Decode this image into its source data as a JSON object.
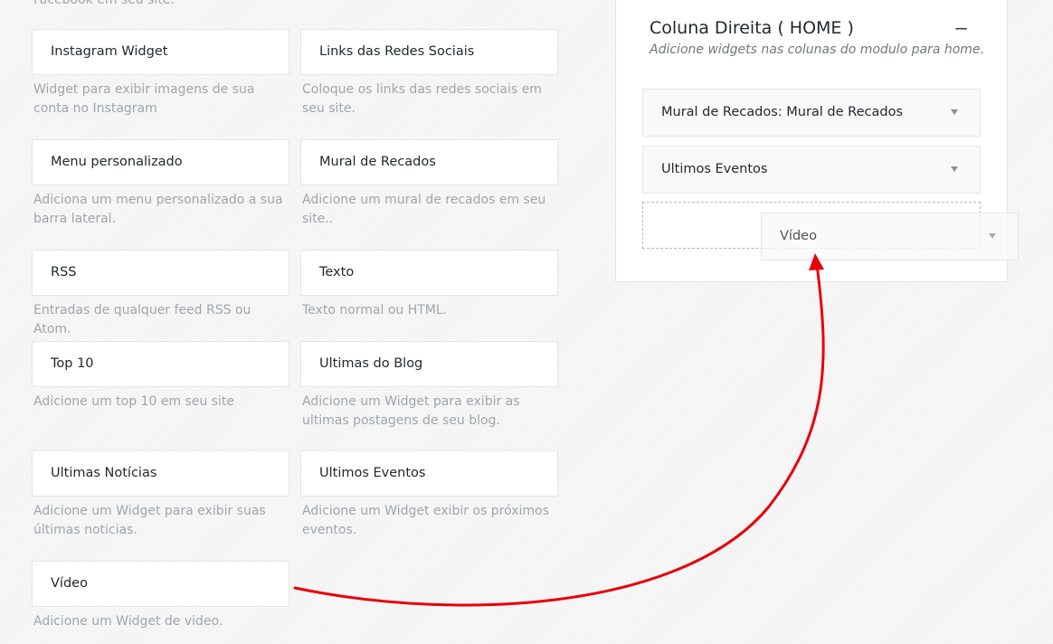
{
  "available_widgets": {
    "top_cut_description": "Facebook em seu site.",
    "items": [
      {
        "title": "Instagram Widget",
        "description": "Widget para exibir imagens de sua conta no Instagram"
      },
      {
        "title": "Links das Redes Sociais",
        "description": "Coloque os links das redes sociais em seu site."
      },
      {
        "title": "Menu personalizado",
        "description": "Adiciona um menu personalizado a sua barra lateral."
      },
      {
        "title": "Mural de Recados",
        "description": "Adicione um mural de recados em seu site.."
      },
      {
        "title": "RSS",
        "description": "Entradas de qualquer feed RSS ou Atom."
      },
      {
        "title": "Texto",
        "description": "Texto normal ou HTML."
      },
      {
        "title": "Top 10",
        "description": "Adicione um top 10 em seu site"
      },
      {
        "title": "Ultimas do Blog",
        "description": "Adicione um Widget para exibir as ultimas postagens de seu blog."
      },
      {
        "title": "Ultimas Notícias",
        "description": "Adicione um Widget para exibir suas últimas noticias."
      },
      {
        "title": "Ultimos Eventos",
        "description": "Adicione um Widget exibir os próximos eventos."
      },
      {
        "title": "Vídeo",
        "description": "Adicione um Widget de video."
      }
    ]
  },
  "sidebar": {
    "title": "Coluna Direita ( HOME )",
    "toggle_symbol": "−",
    "subtitle": "Adicione widgets nas colunas do modulo para home.",
    "widgets": [
      {
        "label": "Mural de Recados: Mural de Recados"
      },
      {
        "label": "Ultimos Eventos"
      }
    ]
  },
  "dragging_widget": {
    "label": "Vídeo"
  },
  "annotation": {
    "arrow_color": "#e8000b"
  }
}
